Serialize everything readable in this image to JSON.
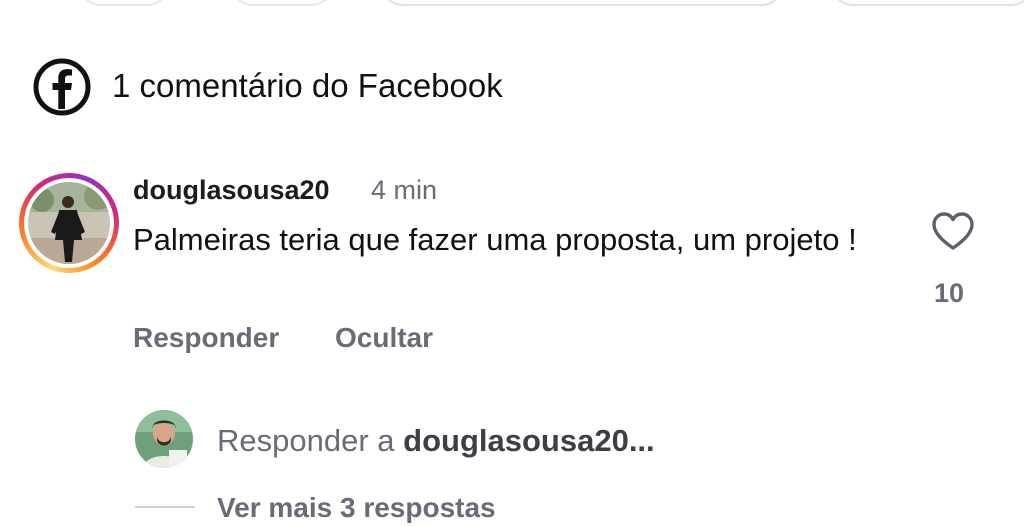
{
  "header": {
    "facebook_comments_label": "1 comentário do Facebook"
  },
  "comment": {
    "author": "douglasousa20",
    "time": "4 min",
    "text": "Palmeiras teria que fazer uma proposta, um projeto !",
    "like_count": "10",
    "actions": {
      "reply": "Responder",
      "hide": "Ocultar"
    }
  },
  "reply_box": {
    "prompt_prefix": "Responder a",
    "prompt_target": "douglasousa20..."
  },
  "see_more": "Ver mais 3 respostas",
  "colors": {
    "text_primary": "#111111",
    "text_secondary": "#6b6b78",
    "story_ring": [
      "#feda75",
      "#fa7e1e",
      "#d62976",
      "#962fbf"
    ]
  },
  "icons": [
    "facebook-icon",
    "heart-icon"
  ]
}
